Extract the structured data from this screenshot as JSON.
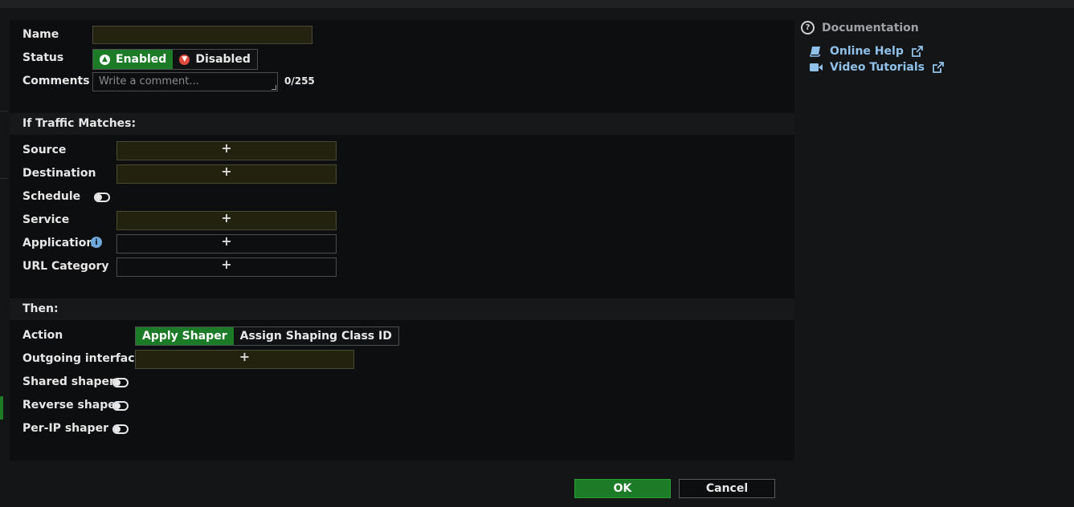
{
  "form": {
    "name_label": "Name",
    "name_value": "",
    "status_label": "Status",
    "status_enabled": "Enabled",
    "status_disabled": "Disabled",
    "comments_label": "Comments",
    "comments_placeholder": "Write a comment...",
    "comments_counter": "0/255"
  },
  "traffic": {
    "header": "If Traffic Matches:",
    "source_label": "Source",
    "destination_label": "Destination",
    "schedule_label": "Schedule",
    "service_label": "Service",
    "application_label": "Application",
    "url_category_label": "URL Category",
    "add_symbol": "+"
  },
  "then": {
    "header": "Then:",
    "action_label": "Action",
    "action_apply": "Apply Shaper",
    "action_assign": "Assign Shaping Class ID",
    "outgoing_label": "Outgoing interface",
    "shared_label": "Shared shaper",
    "reverse_label": "Reverse shaper",
    "perip_label": "Per-IP shaper"
  },
  "documentation": {
    "title": "Documentation",
    "online_help": "Online Help",
    "video_tutorials": "Video Tutorials"
  },
  "buttons": {
    "ok": "OK",
    "cancel": "Cancel"
  },
  "colors": {
    "accent_green": "#1b7b26",
    "link_blue": "#8fc1ea",
    "disabled_red": "#e0493c"
  },
  "icons": [
    "question-circle-icon",
    "book-icon",
    "video-icon",
    "external-link-icon",
    "info-icon",
    "arrow-up-circle-icon",
    "arrow-down-circle-icon"
  ]
}
